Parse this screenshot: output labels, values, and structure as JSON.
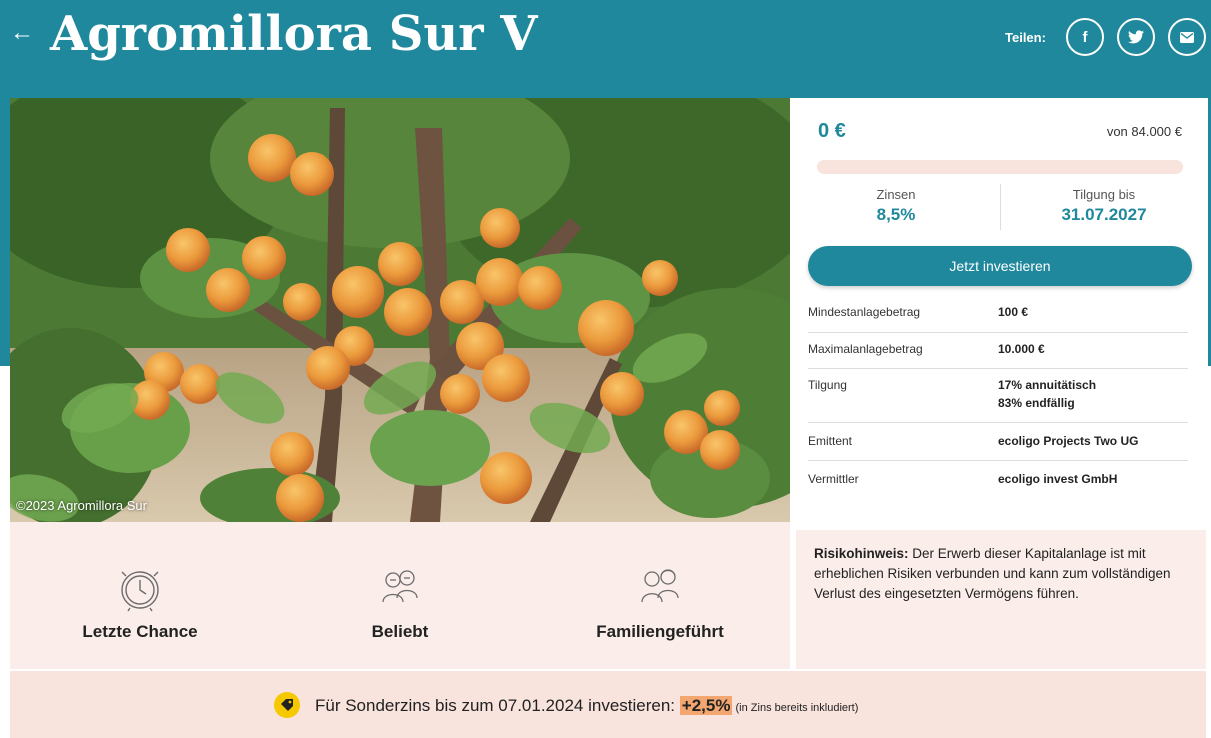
{
  "header": {
    "back_icon": "arrow-left-icon",
    "title": "Agromillora Sur V",
    "share_label": "Teilen:",
    "share_buttons": [
      {
        "icon": "facebook-icon",
        "glyph": "f"
      },
      {
        "icon": "twitter-icon",
        "glyph": "🐦"
      },
      {
        "icon": "mail-icon",
        "glyph": "✉"
      }
    ]
  },
  "photo": {
    "credit": "©2023 Agromillora Sur"
  },
  "invest": {
    "raised": "0 €",
    "goal": "von 84.000 €",
    "progress_fraction": 0,
    "interest_label": "Zinsen",
    "interest_value": "8,5%",
    "repayment_label": "Tilgung bis",
    "repayment_value": "31.07.2027",
    "cta_label": "Jetzt investieren",
    "details": [
      {
        "label": "Mindestanlagebetrag",
        "value": "100 €"
      },
      {
        "label": "Maximalanlagebetrag",
        "value": "10.000 €"
      },
      {
        "label": "Tilgung",
        "value": "17% annuitätisch",
        "value2": "83% endfällig"
      },
      {
        "label": "Emittent",
        "value": "ecoligo Projects Two UG"
      },
      {
        "label": "Vermittler",
        "value": "ecoligo invest GmbH"
      }
    ]
  },
  "features": [
    {
      "icon": "clock-icon",
      "label": "Letzte Chance"
    },
    {
      "icon": "people-icon",
      "label": "Beliebt"
    },
    {
      "icon": "family-icon",
      "label": "Familiengeführt"
    }
  ],
  "risk": {
    "title": "Risikohinweis:",
    "text": " Der Erwerb dieser Kapitalanlage ist mit erheblichen Risiken verbunden und kann zum vollständigen Verlust des eingesetzten Vermögens führen."
  },
  "bonus": {
    "icon": "tag-icon",
    "text": "Für Sonderzins bis zum 07.01.2024 investieren: ",
    "highlight": "+2,5%",
    "note": " (in Zins bereits inkludiert)"
  },
  "colors": {
    "primary": "#20889c",
    "light_bg": "#fbeeea",
    "bonus_bg": "#f8e3dd",
    "highlight": "#f3a66f",
    "tag_yellow": "#f5c800"
  }
}
